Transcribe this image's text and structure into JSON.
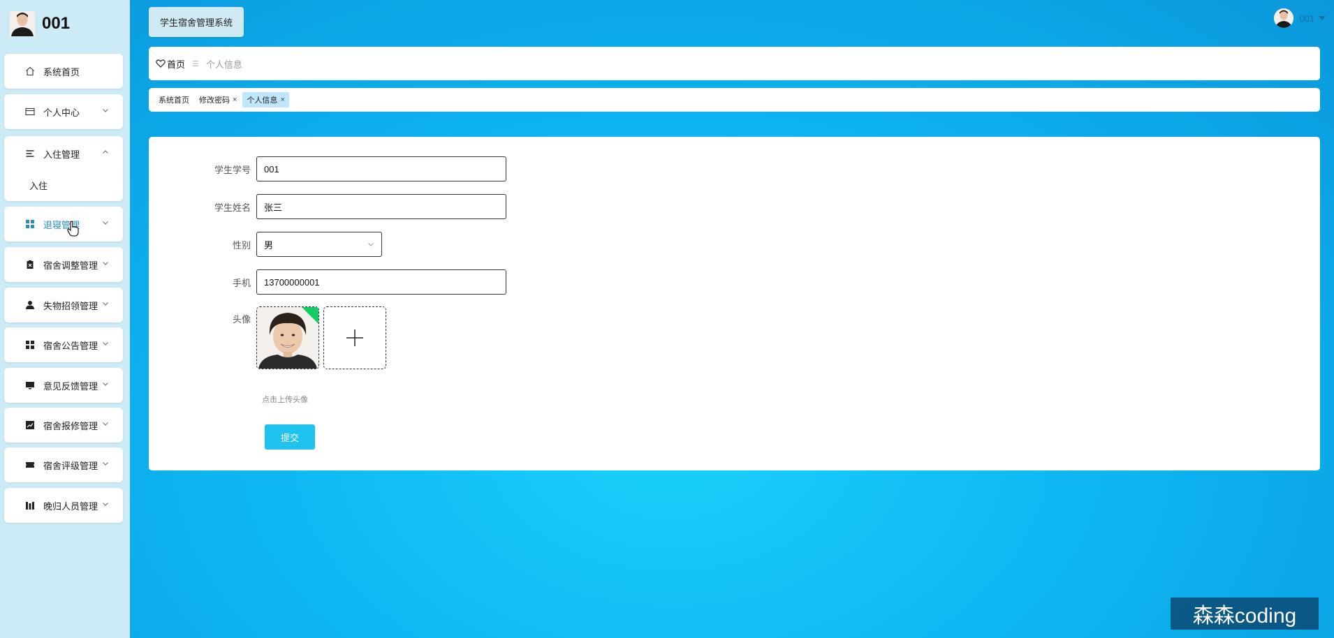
{
  "brand": {
    "title": "001"
  },
  "sidebar": {
    "items": [
      {
        "label": "系统首页",
        "icon": "home-icon"
      },
      {
        "label": "个人中心",
        "icon": "card-icon"
      },
      {
        "label": "入住管理",
        "icon": "list-icon",
        "expanded": true,
        "sub": [
          "入住"
        ]
      },
      {
        "label": "退寝管理",
        "icon": "grid-icon",
        "hovered": true
      },
      {
        "label": "宿舍调整管理",
        "icon": "clipboard-icon"
      },
      {
        "label": "失物招领管理",
        "icon": "person-icon"
      },
      {
        "label": "宿舍公告管理",
        "icon": "grid-icon"
      },
      {
        "label": "意见反馈管理",
        "icon": "monitor-icon"
      },
      {
        "label": "宿舍报修管理",
        "icon": "chart-icon"
      },
      {
        "label": "宿舍评级管理",
        "icon": "ticket-icon"
      },
      {
        "label": "晚归人员管理",
        "icon": "bars-icon"
      }
    ],
    "hover_color": "#2a8fb8"
  },
  "header": {
    "system_title": "学生宿舍管理系统",
    "user_name": "001"
  },
  "breadcrumb": {
    "home": "首页",
    "current": "个人信息"
  },
  "tabs": [
    {
      "label": "系统首页",
      "closable": false,
      "active": false
    },
    {
      "label": "修改密码",
      "closable": true,
      "active": false
    },
    {
      "label": "个人信息",
      "closable": true,
      "active": true
    }
  ],
  "form": {
    "student_id": {
      "label": "学生学号",
      "value": "001"
    },
    "student_name": {
      "label": "学生姓名",
      "value": "张三"
    },
    "gender": {
      "label": "性别",
      "value": "男"
    },
    "phone": {
      "label": "手机",
      "value": "13700000001"
    },
    "avatar": {
      "label": "头像",
      "hint": "点击上传头像"
    },
    "submit_label": "提交"
  },
  "watermark": "森森coding",
  "colors": {
    "sidebar_bg": "#cdeaf7",
    "accent": "#1fc3ef",
    "active_tab": "#bfe6fb",
    "upload_success_badge": "#13ce66"
  }
}
